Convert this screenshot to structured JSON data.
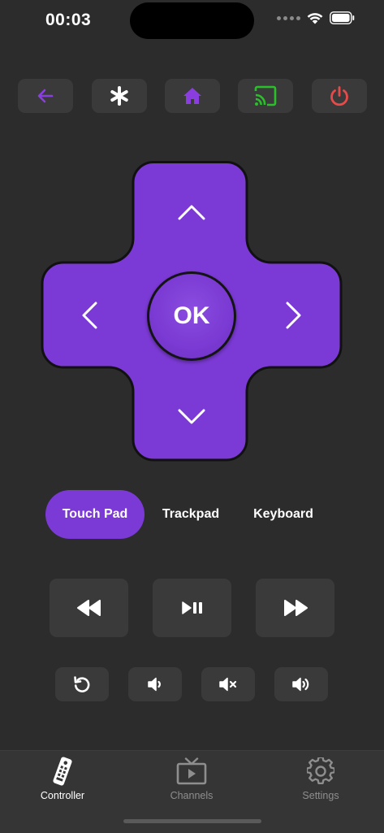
{
  "status_bar": {
    "time": "00:03"
  },
  "colors": {
    "background": "#2c2c2c",
    "button": "#3a3a3a",
    "accent_purple": "#7b3ad5",
    "dpad_purple": "#7b3ad5",
    "cast_green": "#2bbf2b",
    "power_red": "#e84a4a",
    "tab_inactive": "#8e8e8e"
  },
  "top_buttons": [
    {
      "name": "back",
      "icon": "arrow-left-icon"
    },
    {
      "name": "options",
      "icon": "asterisk-icon"
    },
    {
      "name": "home",
      "icon": "home-icon"
    },
    {
      "name": "cast",
      "icon": "cast-icon"
    },
    {
      "name": "power",
      "icon": "power-icon"
    }
  ],
  "dpad": {
    "ok_label": "OK",
    "directions": [
      "up",
      "down",
      "left",
      "right"
    ]
  },
  "mode_tabs": {
    "selected": "Touch Pad",
    "items": [
      "Touch Pad",
      "Trackpad",
      "Keyboard"
    ]
  },
  "media_buttons": [
    {
      "name": "rewind",
      "icon": "rewind-icon"
    },
    {
      "name": "play-pause",
      "icon": "play-pause-icon"
    },
    {
      "name": "fast-forward",
      "icon": "fast-forward-icon"
    }
  ],
  "volume_buttons": [
    {
      "name": "replay",
      "icon": "replay-icon"
    },
    {
      "name": "volume-down",
      "icon": "volume-down-icon"
    },
    {
      "name": "mute",
      "icon": "mute-icon"
    },
    {
      "name": "volume-up",
      "icon": "volume-up-icon"
    }
  ],
  "tab_bar": {
    "selected": "Controller",
    "items": [
      {
        "label": "Controller",
        "icon": "remote-icon"
      },
      {
        "label": "Channels",
        "icon": "tv-icon"
      },
      {
        "label": "Settings",
        "icon": "gear-icon"
      }
    ]
  }
}
